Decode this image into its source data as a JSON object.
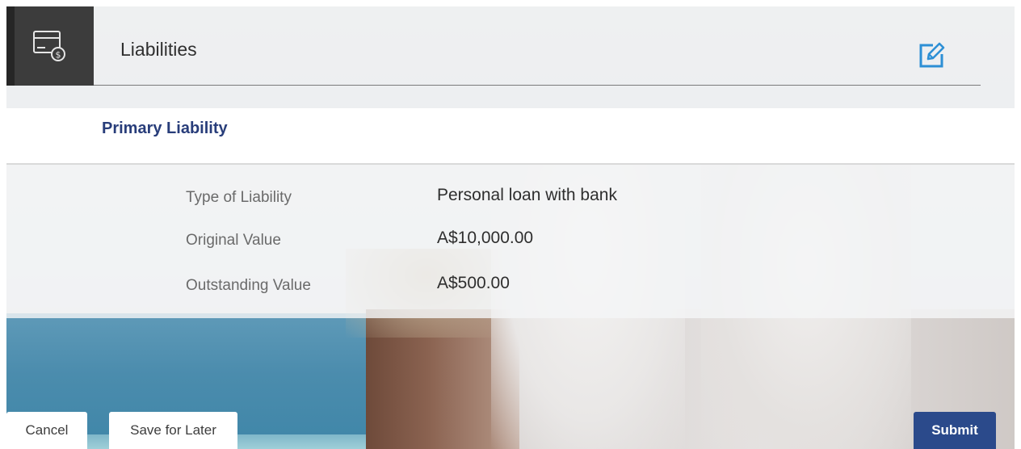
{
  "header": {
    "title": "Liabilities",
    "icon": "liability-card-dollar-icon",
    "edit_icon": "edit-pencil-icon"
  },
  "section": {
    "title": "Primary Liability"
  },
  "details": [
    {
      "label": "Type of Liability",
      "value": "Personal loan with bank"
    },
    {
      "label": "Original Value",
      "value": "A$10,000.00"
    },
    {
      "label": "Outstanding Value",
      "value": "A$500.00"
    }
  ],
  "buttons": {
    "cancel": "Cancel",
    "save_for_later": "Save for Later",
    "submit": "Submit"
  },
  "colors": {
    "section_title": "#283d7a",
    "submit_bg": "#2b4a8b",
    "edit_icon": "#2d8fd5",
    "header_icon_bg": "#3c3c3c"
  }
}
